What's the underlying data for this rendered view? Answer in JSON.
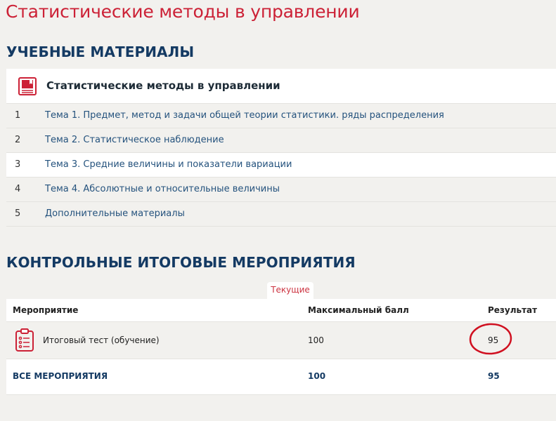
{
  "page": {
    "title": "Статистические методы в управлении"
  },
  "materials": {
    "heading": "УЧЕБНЫЕ МАТЕРИАЛЫ",
    "card_title": "Статистические методы в управлении",
    "card_icon": "book-icon",
    "items": [
      {
        "num": "1",
        "label": "Тема 1. Предмет, метод и задачи общей теории статистики. ряды распределения"
      },
      {
        "num": "2",
        "label": "Тема 2. Статистическое наблюдение"
      },
      {
        "num": "3",
        "label": "Тема 3. Средние величины и показатели вариации"
      },
      {
        "num": "4",
        "label": "Тема 4. Абсолютные и относительные величины"
      },
      {
        "num": "5",
        "label": "Дополнительные материалы"
      }
    ]
  },
  "events": {
    "heading": "КОНТРОЛЬНЫЕ ИТОГОВЫЕ МЕРОПРИЯТИЯ",
    "tab": "Текущие",
    "columns": {
      "event": "Мероприятие",
      "max": "Максимальный балл",
      "result": "Результат"
    },
    "rows": [
      {
        "icon": "clipboard-icon",
        "name": "Итоговый тест (обучение)",
        "max": "100",
        "result": "95"
      }
    ],
    "total": {
      "label": "ВСЕ МЕРОПРИЯТИЯ",
      "max": "100",
      "result": "95"
    }
  },
  "colors": {
    "accent": "#cc2136",
    "heading": "#143a63",
    "link": "#24527d",
    "annotation": "#d01020"
  }
}
